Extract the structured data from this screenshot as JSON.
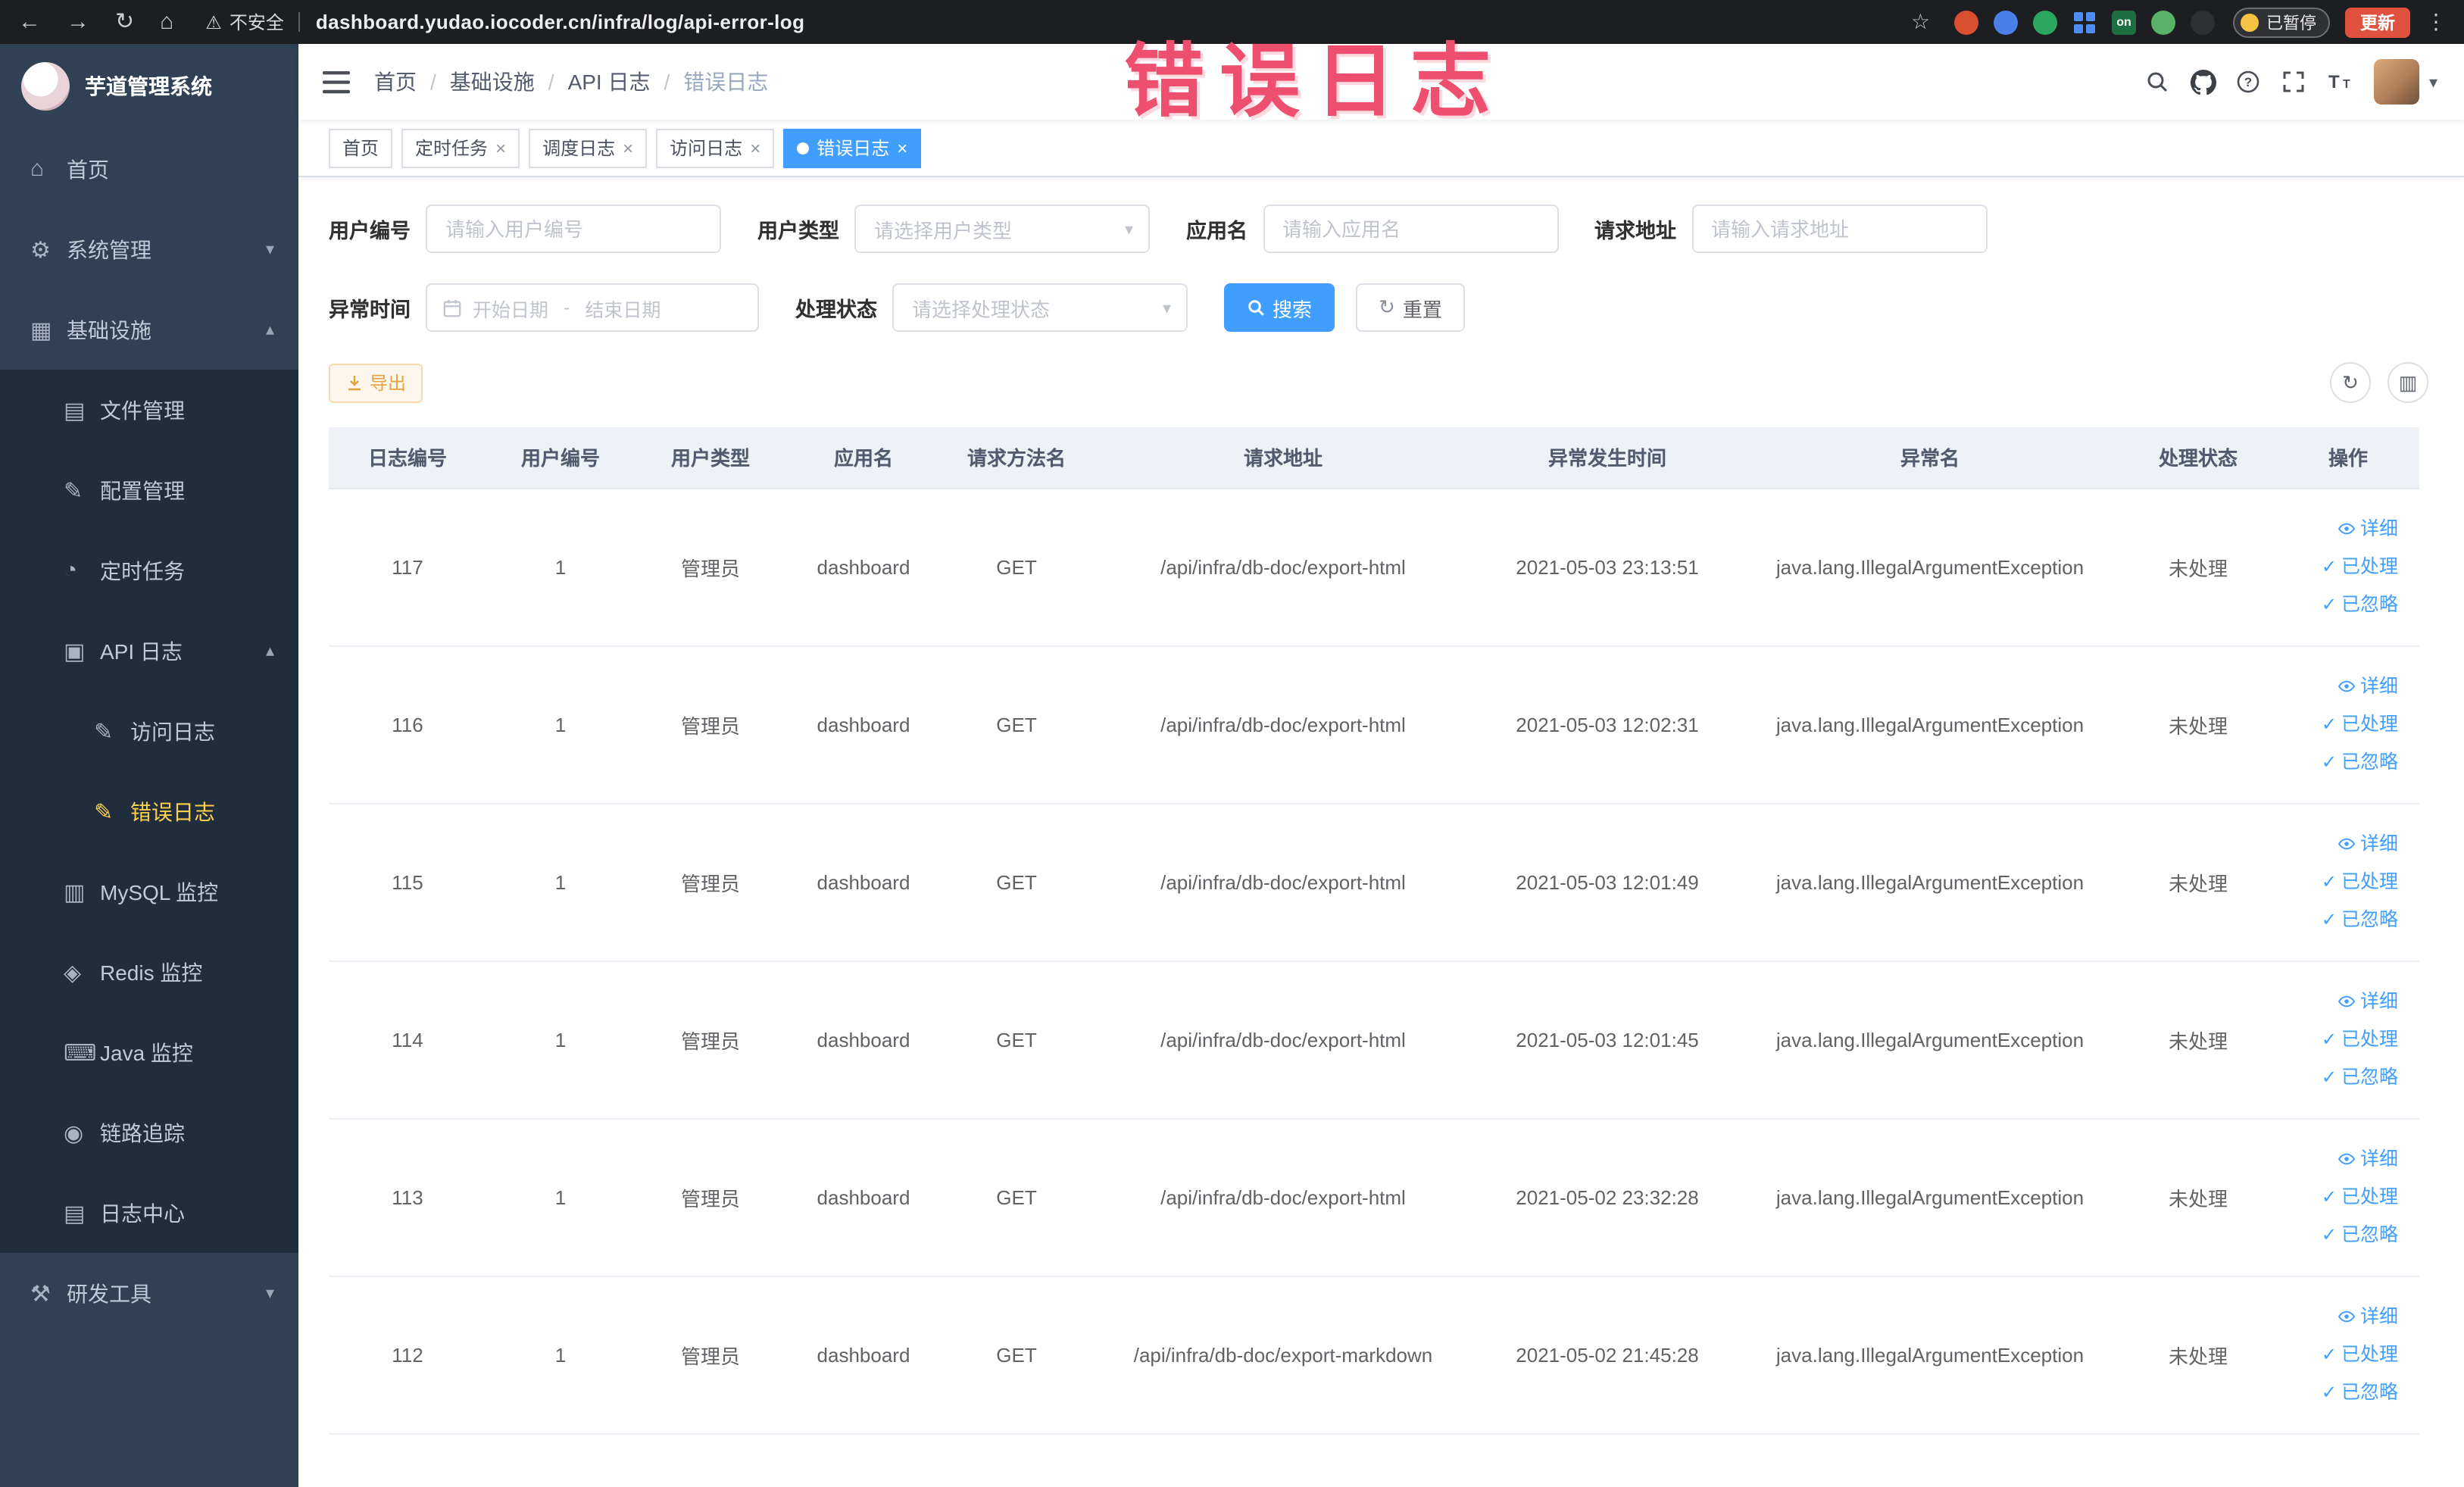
{
  "watermark": "错误日志",
  "breadcrumb_separator": "/",
  "browser": {
    "security_label": "不安全",
    "url": "dashboard.yudao.iocoder.cn/infra/log/api-error-log",
    "on_badge": "on",
    "paused_badge": "已暂停",
    "update_label": "更新"
  },
  "sidebar": {
    "logo_title": "芋道管理系统",
    "home": "首页",
    "system_mgmt": "系统管理",
    "infrastructure": "基础设施",
    "file_mgmt": "文件管理",
    "config_mgmt": "配置管理",
    "scheduled_jobs": "定时任务",
    "api_log": "API 日志",
    "access_log": "访问日志",
    "error_log": "错误日志",
    "mysql_monitor": "MySQL 监控",
    "redis_monitor": "Redis 监控",
    "java_monitor": "Java 监控",
    "trace": "链路追踪",
    "log_center": "日志中心",
    "dev_tools": "研发工具"
  },
  "breadcrumb": [
    "首页",
    "基础设施",
    "API 日志",
    "错误日志"
  ],
  "tabs": [
    "首页",
    "定时任务",
    "调度日志",
    "访问日志",
    "错误日志"
  ],
  "filters": {
    "user_id_label": "用户编号",
    "user_id_placeholder": "请输入用户编号",
    "user_type_label": "用户类型",
    "user_type_placeholder": "请选择用户类型",
    "app_name_label": "应用名",
    "app_name_placeholder": "请输入应用名",
    "request_url_label": "请求地址",
    "request_url_placeholder": "请输入请求地址",
    "exception_time_label": "异常时间",
    "start_date_placeholder": "开始日期",
    "range_separator": "-",
    "end_date_placeholder": "结束日期",
    "process_status_label": "处理状态",
    "process_status_placeholder": "请选择处理状态",
    "search_label": "搜索",
    "reset_label": "重置"
  },
  "toolbar": {
    "export_label": "导出"
  },
  "table": {
    "columns": [
      "日志编号",
      "用户编号",
      "用户类型",
      "应用名",
      "请求方法名",
      "请求地址",
      "异常发生时间",
      "异常名",
      "处理状态",
      "操作"
    ],
    "actions": {
      "detail": "详细",
      "processed": "已处理",
      "ignored": "已忽略"
    },
    "rows": [
      {
        "id": "117",
        "user_id": "1",
        "user_type": "管理员",
        "app": "dashboard",
        "method": "GET",
        "url": "/api/infra/db-doc/export-html",
        "time": "2021-05-03 23:13:51",
        "exception": "java.lang.IllegalArgumentException",
        "status": "未处理"
      },
      {
        "id": "116",
        "user_id": "1",
        "user_type": "管理员",
        "app": "dashboard",
        "method": "GET",
        "url": "/api/infra/db-doc/export-html",
        "time": "2021-05-03 12:02:31",
        "exception": "java.lang.IllegalArgumentException",
        "status": "未处理"
      },
      {
        "id": "115",
        "user_id": "1",
        "user_type": "管理员",
        "app": "dashboard",
        "method": "GET",
        "url": "/api/infra/db-doc/export-html",
        "time": "2021-05-03 12:01:49",
        "exception": "java.lang.IllegalArgumentException",
        "status": "未处理"
      },
      {
        "id": "114",
        "user_id": "1",
        "user_type": "管理员",
        "app": "dashboard",
        "method": "GET",
        "url": "/api/infra/db-doc/export-html",
        "time": "2021-05-03 12:01:45",
        "exception": "java.lang.IllegalArgumentException",
        "status": "未处理"
      },
      {
        "id": "113",
        "user_id": "1",
        "user_type": "管理员",
        "app": "dashboard",
        "method": "GET",
        "url": "/api/infra/db-doc/export-html",
        "time": "2021-05-02 23:32:28",
        "exception": "java.lang.IllegalArgumentException",
        "status": "未处理"
      },
      {
        "id": "112",
        "user_id": "1",
        "user_type": "管理员",
        "app": "dashboard",
        "method": "GET",
        "url": "/api/infra/db-doc/export-markdown",
        "time": "2021-05-02 21:45:28",
        "exception": "java.lang.IllegalArgumentException",
        "status": "未处理"
      }
    ]
  }
}
